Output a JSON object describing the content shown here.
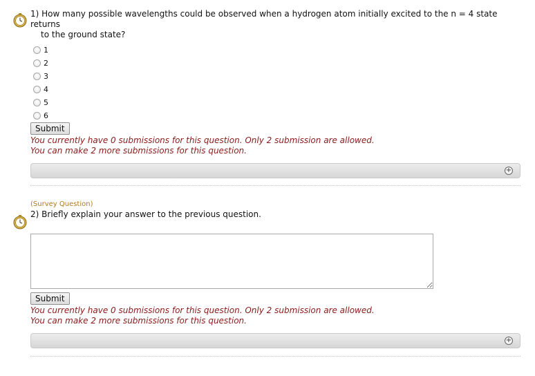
{
  "q1": {
    "number": "1)",
    "text": "How many possible wavelengths could be observed when a hydrogen atom initially excited to the n = 4 state returns",
    "text_line2": "to the ground state?",
    "options": [
      "1",
      "2",
      "3",
      "4",
      "5",
      "6"
    ],
    "submit_label": "Submit",
    "msg1": "You currently have 0 submissions for this question. Only 2 submission are allowed.",
    "msg2": "You can make 2 more submissions for this question.",
    "expand_icon": "+"
  },
  "q2": {
    "tag": "(Survey Question)",
    "number": "2)",
    "text": "Briefly explain your answer to the previous question.",
    "answer_value": "",
    "submit_label": "Submit",
    "msg1": "You currently have 0 submissions for this question. Only 2 submission are allowed.",
    "msg2": "You can make 2 more submissions for this question.",
    "expand_icon": "+"
  }
}
